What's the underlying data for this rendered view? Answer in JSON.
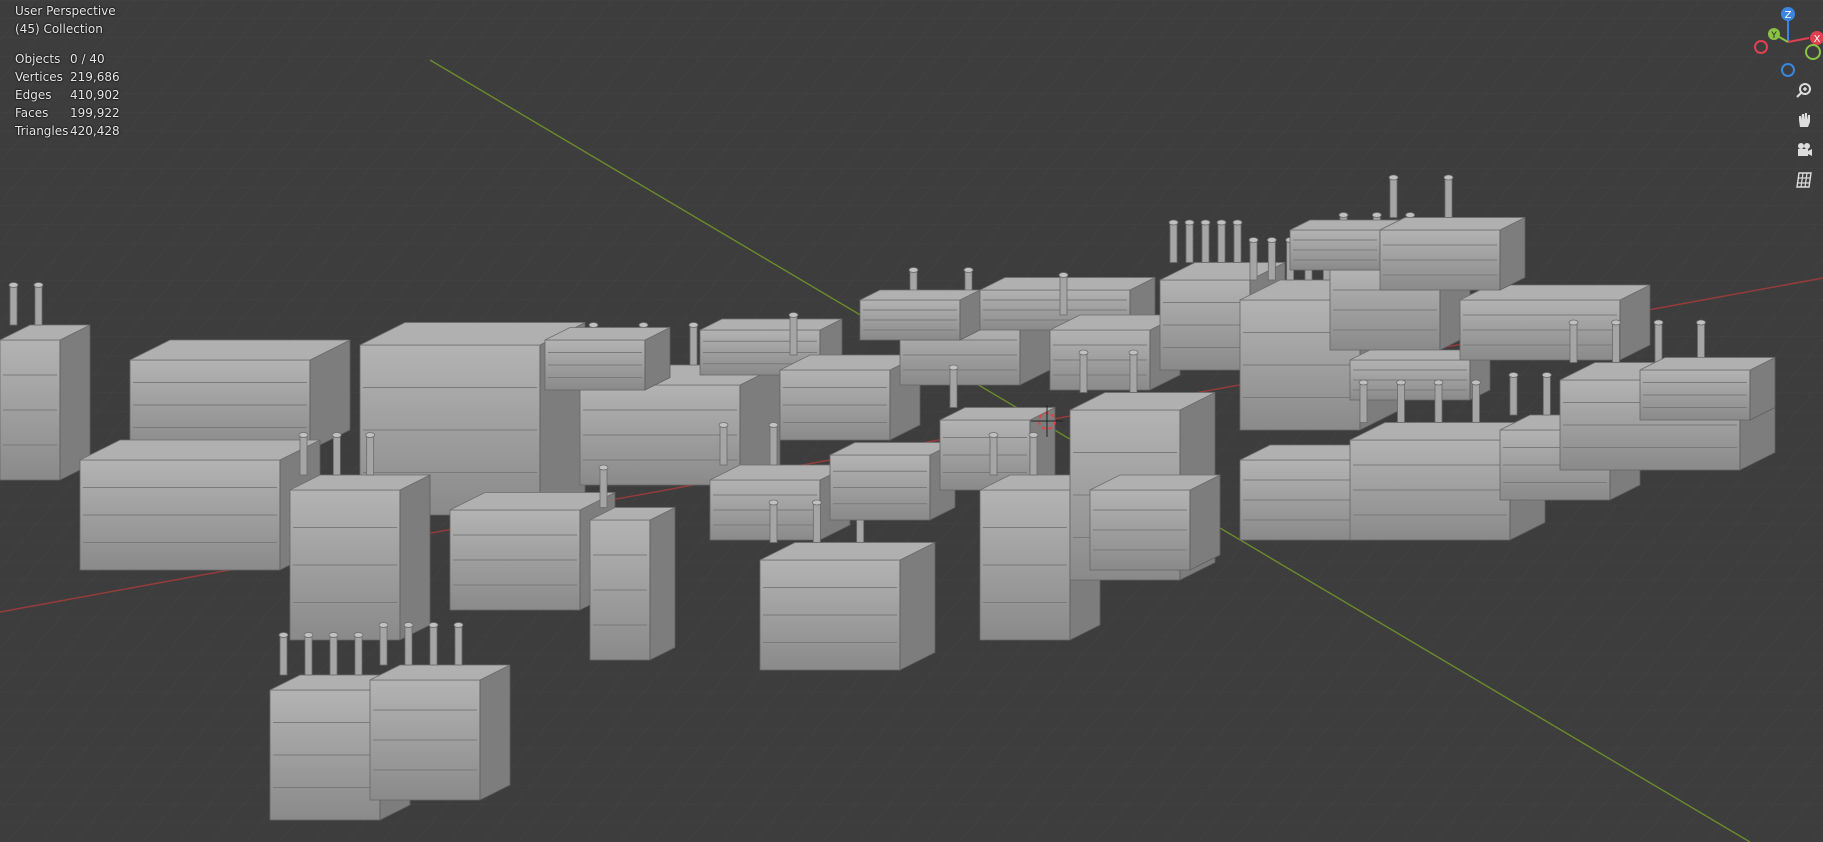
{
  "view": {
    "title": "User Perspective",
    "collection": "(45) Collection"
  },
  "stats": {
    "rows": [
      {
        "label": "Objects",
        "value": "0 / 40"
      },
      {
        "label": "Vertices",
        "value": "219,686"
      },
      {
        "label": "Edges",
        "value": "410,902"
      },
      {
        "label": "Faces",
        "value": "199,922"
      },
      {
        "label": "Triangles",
        "value": "420,428"
      }
    ]
  },
  "gizmo": {
    "z_label": "Z",
    "y_label": "Y",
    "x_label": "X",
    "colors": {
      "x": "#e0404f",
      "y": "#8bc244",
      "z": "#3a86e0"
    }
  },
  "nav_buttons": [
    {
      "name": "zoom-icon"
    },
    {
      "name": "hand-pan-icon"
    },
    {
      "name": "camera-icon"
    },
    {
      "name": "grid-ortho-icon"
    }
  ],
  "colors": {
    "background": "#3d3d3d",
    "grid": "#474747",
    "x_axis": "#9a3b3b",
    "y_axis": "#6b8b2b",
    "model": "#9a9a9a"
  }
}
